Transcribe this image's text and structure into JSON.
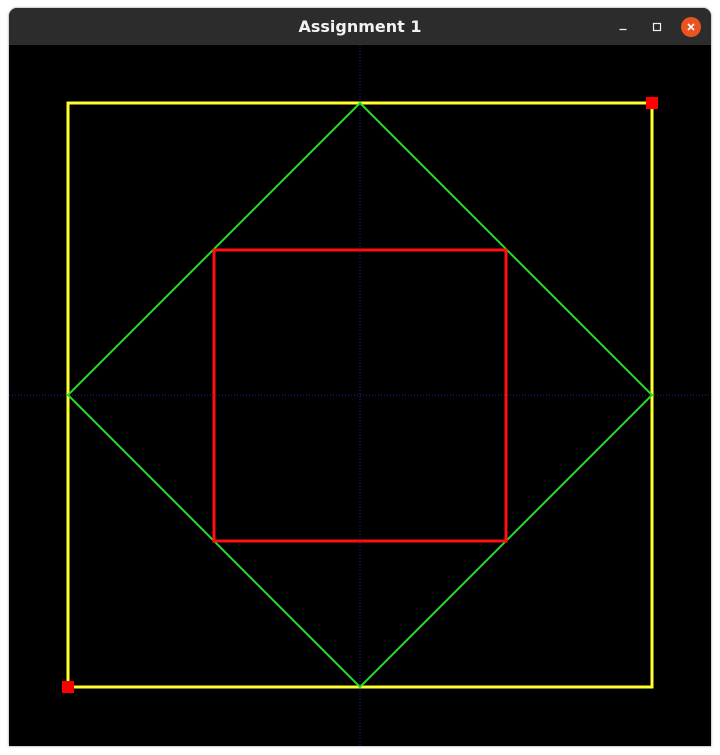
{
  "window": {
    "title": "Assignment 1",
    "controls": {
      "minimize_icon": "minimize-icon",
      "maximize_icon": "maximize-icon",
      "close_icon": "close-icon"
    }
  },
  "colors": {
    "background": "#000000",
    "axes": "#2424a8",
    "outer_square": "#ffff2e",
    "diamond": "#22dd22",
    "inner_square": "#ff1010",
    "control_points": "#ff0000",
    "close_button": "#e95420",
    "titlebar": "#2c2c2c"
  },
  "drawing": {
    "shapes": [
      "axes",
      "outer-square",
      "diamond",
      "inner-square",
      "control-points"
    ]
  }
}
